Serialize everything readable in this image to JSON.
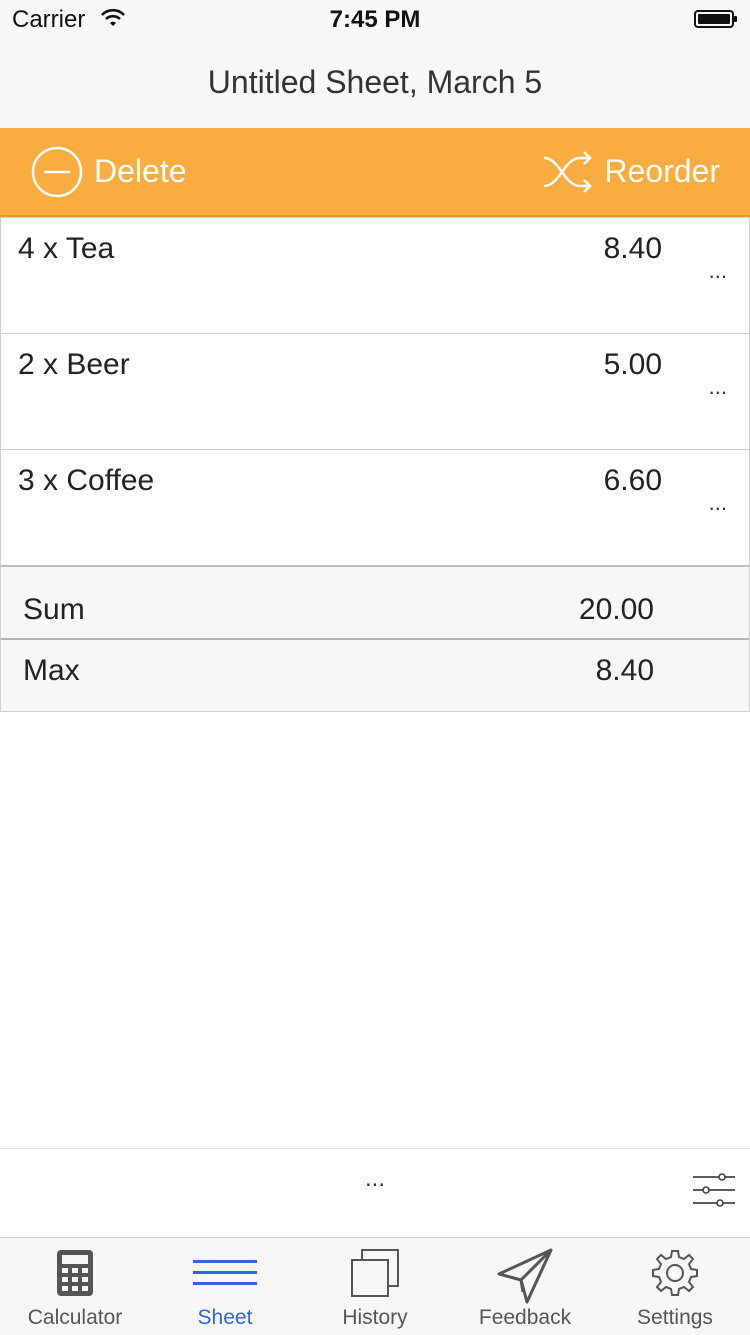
{
  "status_bar": {
    "carrier": "Carrier",
    "time": "7:45 PM"
  },
  "nav": {
    "title": "Untitled Sheet, March 5"
  },
  "toolbar": {
    "delete_label": "Delete",
    "reorder_label": "Reorder",
    "background_color": "#fcad41"
  },
  "items": [
    {
      "label": "4 x Tea",
      "value": "8.40",
      "more": "..."
    },
    {
      "label": "2 x Beer",
      "value": "5.00",
      "more": "..."
    },
    {
      "label": "3 x Coffee",
      "value": "6.60",
      "more": "..."
    }
  ],
  "summary": [
    {
      "label": "Sum",
      "value": "20.00"
    },
    {
      "label": "Max",
      "value": "8.40"
    }
  ],
  "actions": {
    "more": "..."
  },
  "tabs": [
    {
      "label": "Calculator",
      "icon": "calculator-icon"
    },
    {
      "label": "Sheet",
      "icon": "list-lines-icon",
      "active": true
    },
    {
      "label": "History",
      "icon": "stacked-pages-icon"
    },
    {
      "label": "Feedback",
      "icon": "paper-plane-icon"
    },
    {
      "label": "Settings",
      "icon": "gear-icon"
    }
  ],
  "colors": {
    "accent": "#2e67d8",
    "toolbar": "#fcad41"
  }
}
